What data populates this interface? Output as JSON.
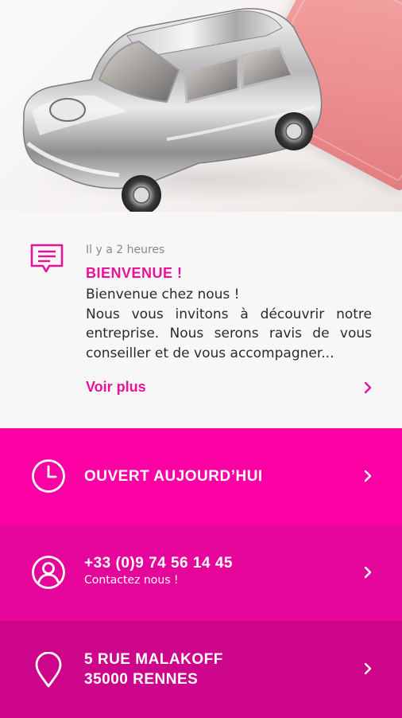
{
  "hero": {
    "image_name": "silver-toy-car-photo"
  },
  "news": {
    "icon": "message-icon",
    "time": "Il y a 2 heures",
    "title": "BIENVENUE !",
    "body_line1": "Bienvenue chez nous !",
    "body_rest": "Nous vous invitons à découvrir notre entreprise. Nous serons ravis de vous conseiller et de vous accompagner...",
    "more_label": "Voir plus"
  },
  "hours": {
    "icon": "clock-icon",
    "label": "OUVERT AUJOURD’HUI"
  },
  "phone": {
    "icon": "user-icon",
    "number": "+33 (0)9 74 56 14 45",
    "subtitle": "Contactez nous !"
  },
  "address": {
    "icon": "location-pin-icon",
    "line1": "5 RUE MALAKOFF",
    "line2": "35000 RENNES"
  },
  "colors": {
    "accent": "#e8119a",
    "row_hours": "#fc00a4",
    "row_phone": "#e6059a",
    "row_address": "#cd058b",
    "news_background": "#f7f7f7"
  }
}
